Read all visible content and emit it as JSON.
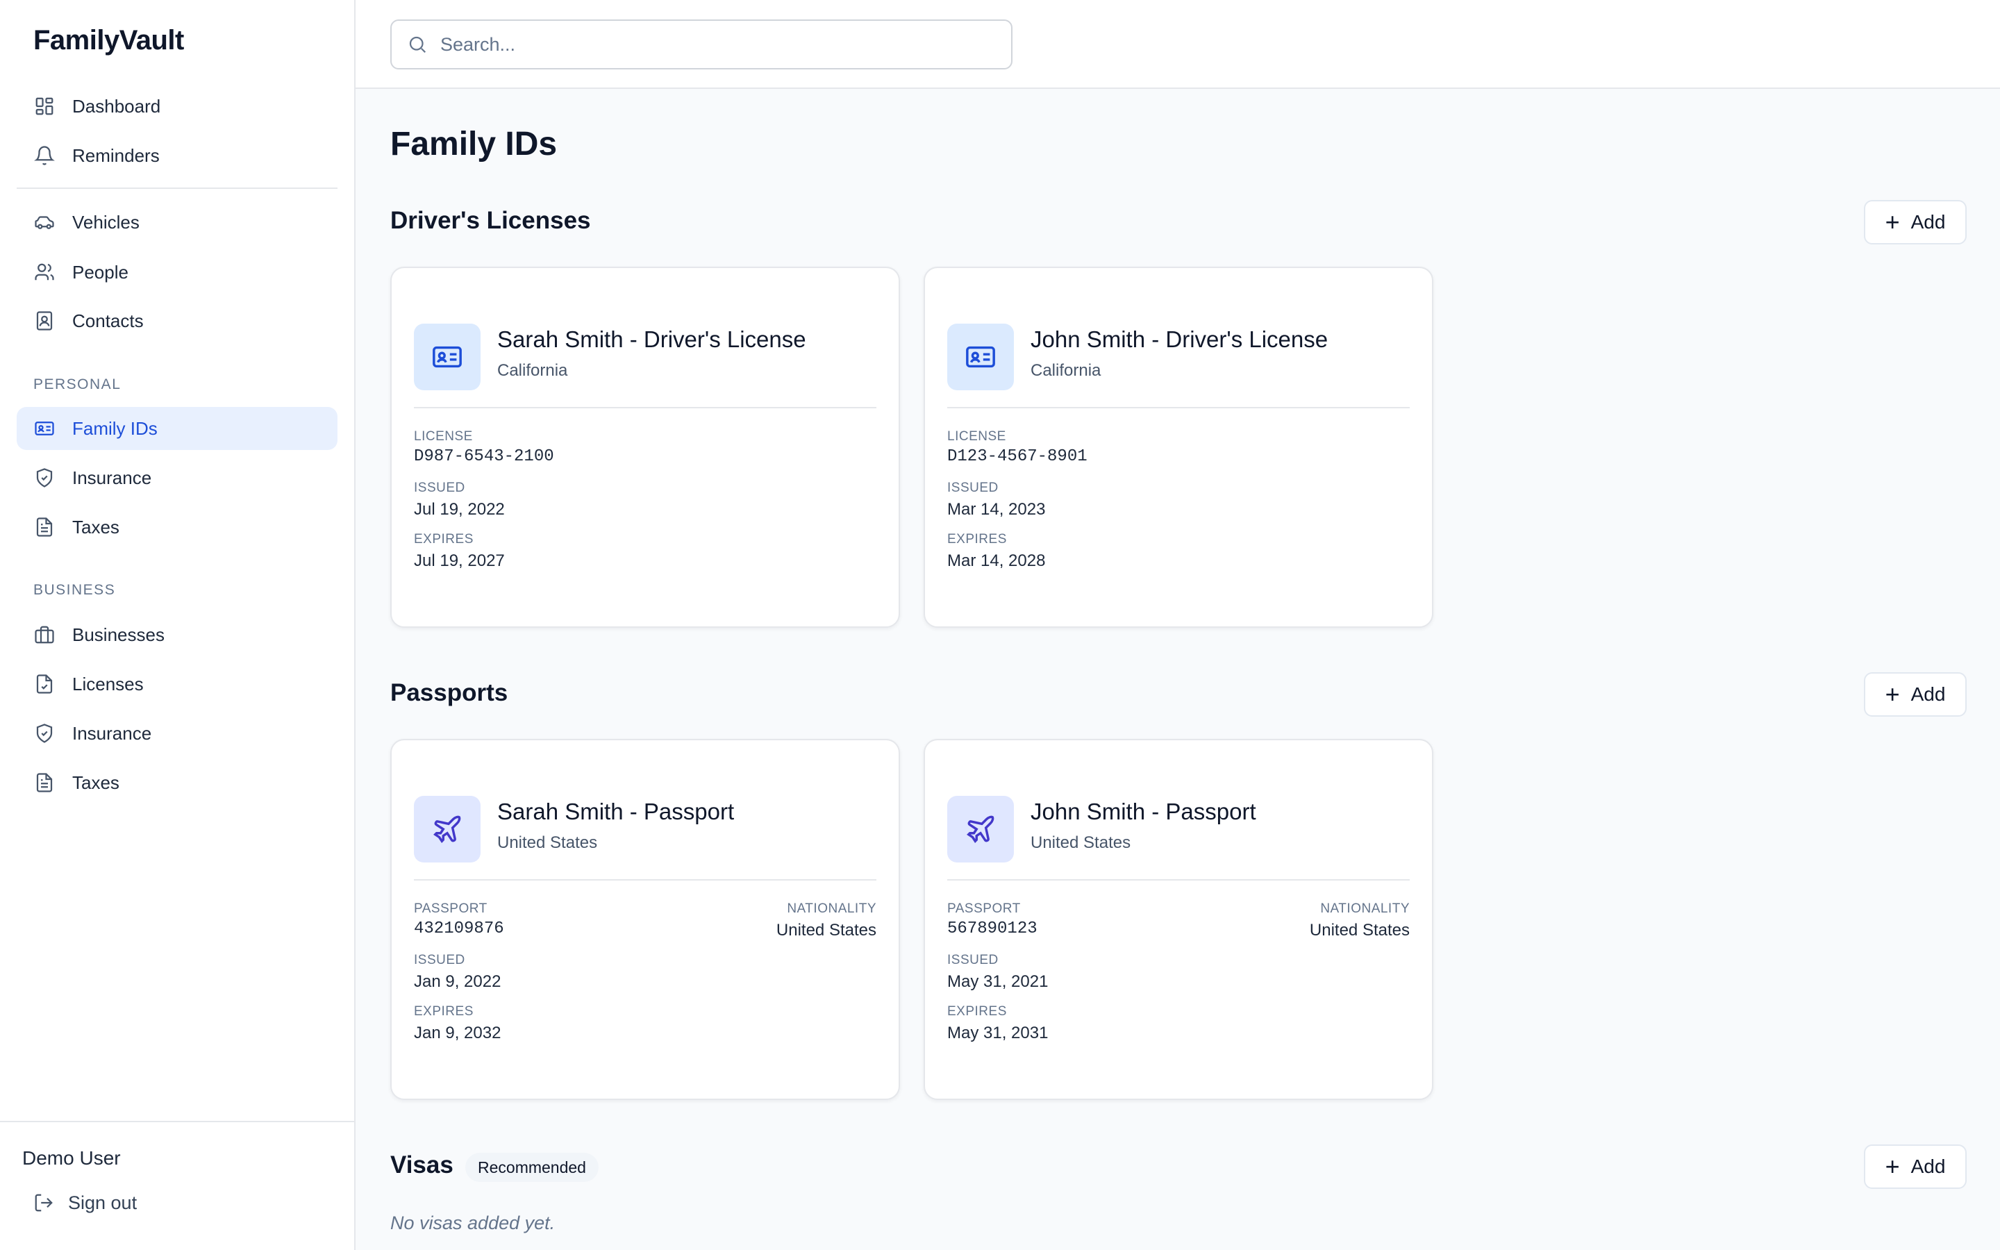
{
  "app": {
    "brand": "FamilyVault"
  },
  "sidebar": {
    "top_items": [
      {
        "label": "Dashboard",
        "icon": "dashboard-icon"
      },
      {
        "label": "Reminders",
        "icon": "bell-icon"
      }
    ],
    "general_items": [
      {
        "label": "Vehicles",
        "icon": "car-icon"
      },
      {
        "label": "People",
        "icon": "users-icon"
      },
      {
        "label": "Contacts",
        "icon": "contact-book-icon"
      }
    ],
    "personal": {
      "heading": "PERSONAL",
      "items": [
        {
          "label": "Family IDs",
          "icon": "id-card-icon",
          "active": true
        },
        {
          "label": "Insurance",
          "icon": "shield-icon"
        },
        {
          "label": "Taxes",
          "icon": "document-icon"
        }
      ]
    },
    "business": {
      "heading": "BUSINESS",
      "items": [
        {
          "label": "Businesses",
          "icon": "briefcase-icon"
        },
        {
          "label": "Licenses",
          "icon": "file-check-icon"
        },
        {
          "label": "Insurance",
          "icon": "shield-icon"
        },
        {
          "label": "Taxes",
          "icon": "document-icon"
        }
      ]
    },
    "footer": {
      "user_name": "Demo User",
      "sign_out": "Sign out"
    },
    "active_color": "#1d4ed8"
  },
  "search": {
    "placeholder": "Search..."
  },
  "main": {
    "title": "Family IDs",
    "add_label": "Add",
    "drivers_licenses": {
      "title": "Driver's Licenses",
      "cards": [
        {
          "name": "Sarah Smith - Driver's License",
          "state": "California",
          "license_label": "LICENSE",
          "license": "D987-6543-2100",
          "issued_label": "ISSUED",
          "issued": "Jul 19, 2022",
          "expires_label": "EXPIRES",
          "expires": "Jul 19, 2027"
        },
        {
          "name": "John Smith - Driver's License",
          "state": "California",
          "license_label": "LICENSE",
          "license": "D123-4567-8901",
          "issued_label": "ISSUED",
          "issued": "Mar 14, 2023",
          "expires_label": "EXPIRES",
          "expires": "Mar 14, 2028"
        }
      ]
    },
    "passports": {
      "title": "Passports",
      "cards": [
        {
          "name": "Sarah Smith - Passport",
          "country": "United States",
          "passport_label": "PASSPORT",
          "passport": "432109876",
          "nationality_label": "NATIONALITY",
          "nationality": "United States",
          "issued_label": "ISSUED",
          "issued": "Jan 9, 2022",
          "expires_label": "EXPIRES",
          "expires": "Jan 9, 2032"
        },
        {
          "name": "John Smith - Passport",
          "country": "United States",
          "passport_label": "PASSPORT",
          "passport": "567890123",
          "nationality_label": "NATIONALITY",
          "nationality": "United States",
          "issued_label": "ISSUED",
          "issued": "May 31, 2021",
          "expires_label": "EXPIRES",
          "expires": "May 31, 2031"
        }
      ]
    },
    "visas": {
      "title": "Visas",
      "badge": "Recommended",
      "empty_text": "No visas added yet."
    }
  }
}
